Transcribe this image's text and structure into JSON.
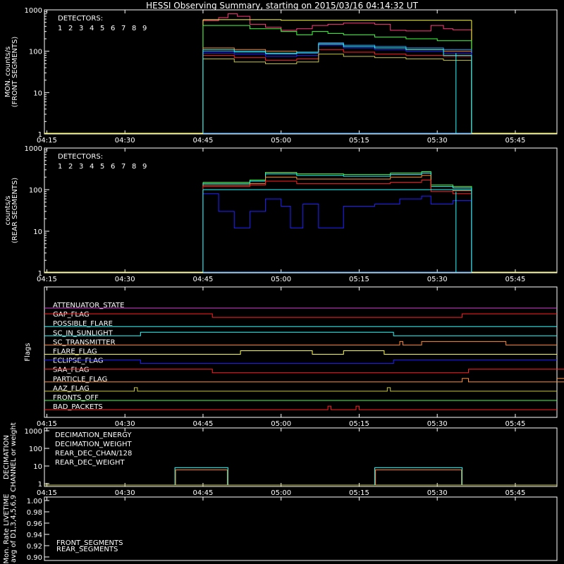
{
  "title": "HESSI Observing Summary, starting on 2015/03/16 04:14:32 UT",
  "x_tick_labels": [
    "04:15",
    "04:30",
    "04:45",
    "05:00",
    "05:15",
    "05:30",
    "05:45"
  ],
  "colors": {
    "axis": "#ffffff",
    "det": [
      "#ff3a7c",
      "#ff2020",
      "#ff8c33",
      "#ffff40",
      "#c8c840",
      "#40ff40",
      "#20ffff",
      "#30a0ff",
      "#2020ff"
    ]
  },
  "chart_data": [
    {
      "type": "line",
      "panel": "front",
      "ylabel_lines": [
        "MON. counts/s",
        "(FRONT SEGMENTS)"
      ],
      "yscale": "log",
      "ylim": [
        1,
        1000
      ],
      "y_tick_labels": [
        "1",
        "10",
        "100",
        "1000"
      ],
      "legend_title": "DETECTORS:",
      "legend_digits": [
        "1",
        "2",
        "3",
        "4",
        "5",
        "6",
        "7",
        "8",
        "9"
      ],
      "series": [
        {
          "color_index": 0,
          "values": [
            [
              4.75,
              550
            ],
            [
              4.8,
              650
            ],
            [
              4.83,
              800
            ],
            [
              4.86,
              700
            ],
            [
              4.9,
              450
            ],
            [
              4.95,
              380
            ],
            [
              5.0,
              320
            ],
            [
              5.05,
              350
            ],
            [
              5.1,
              420
            ],
            [
              5.15,
              450
            ],
            [
              5.2,
              480
            ],
            [
              5.3,
              450
            ],
            [
              5.35,
              320
            ],
            [
              5.4,
              310
            ],
            [
              5.48,
              420
            ],
            [
              5.52,
              350
            ],
            [
              5.55,
              330
            ],
            [
              5.61,
              300
            ]
          ]
        },
        {
          "color_index": 3,
          "values": [
            [
              4.75,
              580
            ],
            [
              5.0,
              560
            ],
            [
              5.2,
              560
            ],
            [
              5.45,
              560
            ],
            [
              5.61,
              560
            ]
          ]
        },
        {
          "color_index": 5,
          "values": [
            [
              4.75,
              420
            ],
            [
              4.9,
              350
            ],
            [
              5.0,
              300
            ],
            [
              5.05,
              250
            ],
            [
              5.1,
              300
            ],
            [
              5.15,
              270
            ],
            [
              5.2,
              250
            ],
            [
              5.3,
              220
            ],
            [
              5.4,
              200
            ],
            [
              5.5,
              180
            ],
            [
              5.61,
              160
            ]
          ]
        },
        {
          "color_index": 2,
          "values": [
            [
              4.75,
              120
            ],
            [
              4.85,
              110
            ],
            [
              4.95,
              100
            ],
            [
              5.05,
              95
            ],
            [
              5.12,
              150
            ],
            [
              5.2,
              130
            ],
            [
              5.3,
              120
            ],
            [
              5.4,
              110
            ],
            [
              5.52,
              100
            ],
            [
              5.61,
              90
            ]
          ]
        },
        {
          "color_index": 7,
          "values": [
            [
              4.75,
              100
            ],
            [
              4.85,
              95
            ],
            [
              4.95,
              85
            ],
            [
              5.05,
              90
            ],
            [
              5.12,
              160
            ],
            [
              5.2,
              140
            ],
            [
              5.3,
              130
            ],
            [
              5.4,
              120
            ],
            [
              5.52,
              110
            ],
            [
              5.61,
              90
            ]
          ]
        },
        {
          "color_index": 8,
          "values": [
            [
              4.75,
              90
            ],
            [
              4.85,
              85
            ],
            [
              4.95,
              75
            ],
            [
              5.05,
              80
            ],
            [
              5.12,
              140
            ],
            [
              5.2,
              120
            ],
            [
              5.3,
              110
            ],
            [
              5.4,
              100
            ],
            [
              5.52,
              90
            ],
            [
              5.61,
              70
            ]
          ]
        },
        {
          "color_index": 1,
          "values": [
            [
              4.75,
              80
            ],
            [
              4.85,
              70
            ],
            [
              4.95,
              60
            ],
            [
              5.05,
              65
            ],
            [
              5.12,
              110
            ],
            [
              5.2,
              95
            ],
            [
              5.3,
              85
            ],
            [
              5.4,
              80
            ],
            [
              5.52,
              75
            ],
            [
              5.61,
              60
            ]
          ]
        },
        {
          "color_index": 4,
          "values": [
            [
              4.75,
              65
            ],
            [
              4.85,
              55
            ],
            [
              4.95,
              50
            ],
            [
              5.05,
              55
            ],
            [
              5.12,
              85
            ],
            [
              5.2,
              75
            ],
            [
              5.3,
              70
            ],
            [
              5.4,
              65
            ],
            [
              5.52,
              60
            ],
            [
              5.61,
              55
            ]
          ]
        },
        {
          "color_index": 6,
          "values": [
            [
              4.75,
              110
            ],
            [
              4.85,
              100
            ],
            [
              4.95,
              90
            ],
            [
              5.05,
              95
            ],
            [
              5.12,
              150
            ],
            [
              5.2,
              130
            ],
            [
              5.3,
              120
            ],
            [
              5.4,
              110
            ],
            [
              5.52,
              80
            ]
          ]
        }
      ]
    },
    {
      "type": "line",
      "panel": "rear",
      "ylabel_lines": [
        "counts/s",
        "(REAR SEGMENTS)"
      ],
      "yscale": "log",
      "ylim": [
        1,
        1000
      ],
      "y_tick_labels": [
        "1",
        "10",
        "100",
        "1000"
      ],
      "legend_title": "DETECTORS:",
      "legend_digits": [
        "1",
        "2",
        "3",
        "4",
        "5",
        "6",
        "7",
        "8",
        "9"
      ],
      "series": [
        {
          "color_index": 5,
          "values": [
            [
              4.75,
              150
            ],
            [
              4.9,
              170
            ],
            [
              4.95,
              260
            ],
            [
              5.05,
              240
            ],
            [
              5.2,
              230
            ],
            [
              5.35,
              250
            ],
            [
              5.45,
              270
            ],
            [
              5.48,
              130
            ],
            [
              5.55,
              120
            ],
            [
              5.61,
              110
            ]
          ]
        },
        {
          "color_index": 6,
          "values": [
            [
              4.75,
              140
            ],
            [
              4.9,
              160
            ],
            [
              4.95,
              240
            ],
            [
              5.05,
              220
            ],
            [
              5.2,
              210
            ],
            [
              5.35,
              230
            ],
            [
              5.45,
              250
            ],
            [
              5.48,
              120
            ],
            [
              5.55,
              110
            ],
            [
              5.61,
              100
            ]
          ]
        },
        {
          "color_index": 2,
          "values": [
            [
              4.75,
              130
            ],
            [
              4.9,
              140
            ],
            [
              4.95,
              200
            ],
            [
              5.05,
              180
            ],
            [
              5.2,
              180
            ],
            [
              5.35,
              200
            ],
            [
              5.45,
              220
            ],
            [
              5.48,
              100
            ],
            [
              5.55,
              95
            ],
            [
              5.61,
              90
            ]
          ]
        },
        {
          "color_index": 1,
          "values": [
            [
              4.75,
              120
            ],
            [
              4.9,
              130
            ],
            [
              4.95,
              160
            ],
            [
              5.05,
              140
            ],
            [
              5.2,
              140
            ],
            [
              5.35,
              150
            ],
            [
              5.45,
              170
            ],
            [
              5.48,
              90
            ],
            [
              5.55,
              80
            ],
            [
              5.61,
              75
            ]
          ]
        },
        {
          "color_index": 8,
          "values": [
            [
              4.75,
              80
            ],
            [
              4.8,
              30
            ],
            [
              4.85,
              12
            ],
            [
              4.9,
              30
            ],
            [
              4.95,
              60
            ],
            [
              5.0,
              40
            ],
            [
              5.03,
              12
            ],
            [
              5.07,
              45
            ],
            [
              5.12,
              12
            ],
            [
              5.2,
              40
            ],
            [
              5.3,
              45
            ],
            [
              5.38,
              60
            ],
            [
              5.45,
              70
            ],
            [
              5.48,
              45
            ],
            [
              5.55,
              55
            ],
            [
              5.61,
              60
            ]
          ]
        },
        {
          "color_index": 6,
          "values": [
            [
              4.75,
              100
            ],
            [
              5.45,
              100
            ],
            [
              5.5,
              100
            ]
          ]
        }
      ]
    }
  ],
  "flags": {
    "ylabel": "Flags",
    "items": [
      {
        "label": "ATTENUATOR_STATE",
        "color": "#d040d0",
        "steps": [
          [
            4.0,
            0
          ]
        ]
      },
      {
        "label": "GAP_FLAG",
        "color": "#ff2020",
        "steps": [
          [
            4.0,
            1
          ],
          [
            4.78,
            0
          ],
          [
            5.58,
            1
          ]
        ]
      },
      {
        "label": "POSSIBLE_FLARE",
        "color": "#20ffff",
        "steps": [
          [
            4.0,
            0
          ]
        ]
      },
      {
        "label": "SC_IN_SUNLIGHT",
        "color": "#20ffff",
        "steps": [
          [
            4.0,
            0
          ],
          [
            4.55,
            1
          ],
          [
            5.36,
            0
          ]
        ]
      },
      {
        "label": "SC_TRANSMITTER",
        "color": "#ff8c33",
        "steps": [
          [
            4.0,
            0
          ],
          [
            5.38,
            1
          ],
          [
            5.39,
            0
          ],
          [
            5.45,
            1
          ],
          [
            5.72,
            0
          ]
        ]
      },
      {
        "label": "FLARE_FLAG",
        "color": "#ffff40",
        "steps": [
          [
            4.0,
            0
          ],
          [
            4.87,
            1
          ],
          [
            5.1,
            0
          ],
          [
            5.2,
            1
          ],
          [
            5.33,
            0
          ]
        ]
      },
      {
        "label": "ECLIPSE_FLAG",
        "color": "#2020ff",
        "steps": [
          [
            4.0,
            1
          ],
          [
            4.55,
            0
          ],
          [
            5.36,
            1
          ]
        ]
      },
      {
        "label": "SAA_FLAG",
        "color": "#ff2020",
        "steps": [
          [
            4.0,
            1
          ],
          [
            4.78,
            0
          ],
          [
            5.6,
            1
          ],
          [
            5.92,
            1
          ]
        ]
      },
      {
        "label": "PARTICLE_FLAG",
        "color": "#ff8c33",
        "steps": [
          [
            4.0,
            0
          ],
          [
            5.58,
            1
          ],
          [
            5.6,
            0
          ],
          [
            5.92,
            1
          ]
        ]
      },
      {
        "label": "AAZ_FLAG",
        "color": "#c8c840",
        "steps": [
          [
            4.0,
            0
          ],
          [
            4.53,
            1
          ],
          [
            4.54,
            0
          ],
          [
            5.34,
            1
          ],
          [
            5.35,
            0
          ]
        ]
      },
      {
        "label": "FRONTS_OFF",
        "color": "#40ff40",
        "steps": [
          [
            4.0,
            0
          ]
        ]
      },
      {
        "label": "BAD_PACKETS",
        "color": "#ff2020",
        "steps": [
          [
            4.0,
            0
          ],
          [
            5.15,
            1
          ],
          [
            5.16,
            0
          ],
          [
            5.24,
            1
          ],
          [
            5.25,
            0
          ]
        ]
      }
    ]
  },
  "decimation": {
    "ylabel_lines": [
      "DECIMATION",
      "CHANNEL or weight"
    ],
    "y_tick_labels": [
      "1",
      "10",
      "100",
      "1000"
    ],
    "legend": [
      {
        "label": "DECIMATION_ENERGY",
        "color": "#40ff40"
      },
      {
        "label": "DECIMATION_WEIGHT",
        "color": "#ff8c33"
      },
      {
        "label": "REAR_DEC_CHAN/128",
        "color": "#20ffff"
      },
      {
        "label": "REAR_DEC_WEIGHT",
        "color": "#c8c840"
      }
    ],
    "segments": [
      [
        4.66,
        4.83,
        8
      ],
      [
        5.3,
        5.58,
        8
      ]
    ]
  },
  "livetime": {
    "ylabel_lines": [
      "Mon. Rate LIVETIME",
      "avg of D1,3,4,5,6,9"
    ],
    "y_tick_labels": [
      "0.90",
      "0.92",
      "0.94",
      "0.96",
      "0.98",
      "1.00"
    ],
    "legend": [
      {
        "label": "FRONT_SEGMENTS",
        "color": "#40ff40"
      },
      {
        "label": "REAR_SEGMENTS",
        "color": "#308030"
      }
    ]
  }
}
